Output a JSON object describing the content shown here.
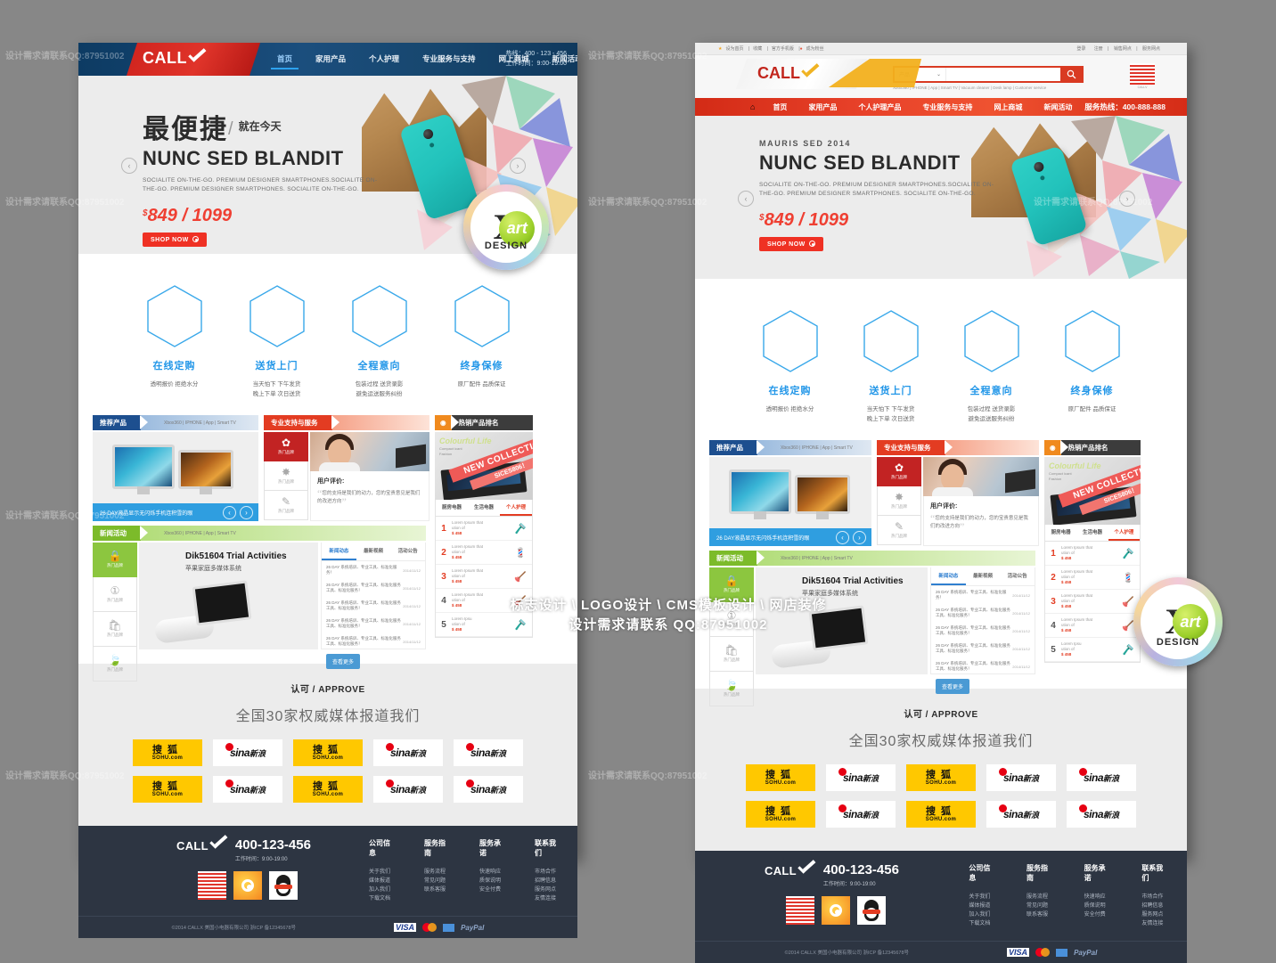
{
  "watermark": {
    "line1": "标志设计 \\ LOGO设计 \\ CMS模板设计 \\ 网店装修",
    "line2": "设计需求请联系 QQ:87951002",
    "faint": "设计需求请联系QQ:87951002"
  },
  "badge": {
    "x": "X",
    "art": "art",
    "design": "DESIGN"
  },
  "left": {
    "brand": "CALL",
    "nav": [
      {
        "label": "首页",
        "active": true
      },
      {
        "label": "家用产品",
        "active": false
      },
      {
        "label": "个人护理",
        "active": false
      },
      {
        "label": "专业服务与支持",
        "active": false
      },
      {
        "label": "网上商城",
        "active": false
      },
      {
        "label": "新闻活动",
        "active": false
      }
    ],
    "hotline_l1": "热线：400 - 123 - 456",
    "hotline_l2": "工作时间：9:00-19:00",
    "hero": {
      "cn_big": "最便捷",
      "cn_slash": "/",
      "cn_small": "就在今天",
      "h1": "NUNC SED BLANDIT",
      "paragraph": "SOCIALITE ON-THE-GO. PREMIUM DESIGNER SMARTPHONES.SOCIALITE ON-THE-GO. PREMIUM DESIGNER SMARTPHONES. SOCIALITE ON-THE-GO.",
      "currency": "$",
      "price": "849 / 1099",
      "cta": "SHOP NOW",
      "arrow_prev": "‹",
      "arrow_next": "›"
    }
  },
  "right": {
    "brand": "CALL",
    "util_left": [
      {
        "label": "设为首页",
        "icon": "star"
      },
      {
        "label": "收藏",
        "icon": ""
      },
      {
        "label": "官方手机版",
        "icon": ""
      },
      {
        "label": "成为粉丝",
        "icon": "dot"
      }
    ],
    "util_right": [
      "登录",
      "注册",
      "销售网点",
      "服务网点"
    ],
    "search": {
      "category": "产品",
      "chevron": "⌄",
      "value": "",
      "placeholder": "",
      "button_icon": "search-icon",
      "keywords": "Xbox360 | IPHONE | App | Smart TV | Vacuum cleaner | Desk lamp | Customer service"
    },
    "qr_caption": "CALLV",
    "nav": [
      {
        "label": "首页"
      },
      {
        "label": "家用产品"
      },
      {
        "label": "个人护理产品"
      },
      {
        "label": "专业服务与支持"
      },
      {
        "label": "网上商城"
      },
      {
        "label": "新闻活动"
      }
    ],
    "nav_hotline": "服务热线：400-888-888",
    "hero": {
      "kicker": "MAURIS SED 2014",
      "h1": "NUNC SED BLANDIT",
      "paragraph": "SOCIALITE ON-THE-GO. PREMIUM DESIGNER SMARTPHONES.SOCIALITE ON-THE-GO. PREMIUM DESIGNER SMARTPHONES. SOCIALITE ON-THE-GO.",
      "currency": "$",
      "price": "849 / 1099",
      "cta": "SHOP NOW",
      "arrow_prev": "‹",
      "arrow_next": "›"
    }
  },
  "features": [
    {
      "title": "在线定购",
      "desc": "透明报价  拒绝水分"
    },
    {
      "title": "送货上门",
      "desc": "当天怕下  下午发货\n晚上下单  次日送货"
    },
    {
      "title": "全程意向",
      "desc": "包装过程  送货录影\n避免运送服务纠纷"
    },
    {
      "title": "终身保修",
      "desc": "原厂配件  品质保证"
    }
  ],
  "panels": {
    "recommend": {
      "tag": "推荐产品",
      "keywords": "Xbox360 | IPHONE | App | Smart TV",
      "caption": "26 DAY液晶显示无闪烁手机连积雪的眼"
    },
    "support": {
      "tag": "专业支持与服务",
      "tiles": [
        {
          "glyph": "✿",
          "label": "热门品牌"
        },
        {
          "glyph": "✸",
          "label": "热门品牌"
        },
        {
          "glyph": "✎",
          "label": "热门品牌"
        }
      ],
      "review_title": "用户评价:",
      "review_text": "您的支持是我们的动力，您的宝贵意见是我们的改进方向"
    },
    "ranking": {
      "tag": "热销产品排名",
      "banner_title": "Colourful Life",
      "banner_sub": "Compact icant\nFashion",
      "ribbon": "NEW COLLECTION",
      "ribbon2": "SICES806！",
      "tabs": [
        {
          "label": "厨房电器",
          "active": false
        },
        {
          "label": "生活电器",
          "active": false
        },
        {
          "label": "个人护理",
          "active": true
        }
      ],
      "rows": [
        {
          "no": "1",
          "title": "Lorem Ipsum that",
          "sub": "ution of",
          "price": "$ 458",
          "icon": "🪒"
        },
        {
          "no": "2",
          "title": "Lorem Ipsum that",
          "sub": "ution of",
          "price": "$ 458",
          "icon": "💈"
        },
        {
          "no": "3",
          "title": "Lorem Ipsum that",
          "sub": "ution of",
          "price": "$ 458",
          "icon": "🪠"
        },
        {
          "no": "4",
          "title": "Lorem Ipsum that",
          "sub": "ution of",
          "price": "$ 458",
          "icon": "🪠"
        },
        {
          "no": "5",
          "title": "Lorem Ipsu",
          "sub": "ution of",
          "price": "$ 458",
          "icon": "🪒"
        }
      ]
    },
    "news": {
      "tag": "新闻活动",
      "keywords": "Xbox360 | IPHONE | App | Smart TV",
      "tiles": [
        {
          "glyph": "🔒",
          "label": "热门品牌"
        },
        {
          "glyph": "①",
          "label": "热门品牌"
        },
        {
          "glyph": "🛍",
          "label": "热门品牌"
        },
        {
          "glyph": "🍃",
          "label": "热门品牌"
        }
      ],
      "headline": "Dik51604 Trial Activities",
      "subhead": "苹果家庭多媒体系统",
      "tabs": [
        {
          "label": "新闻动态",
          "active": true
        },
        {
          "label": "最新视频",
          "active": false
        },
        {
          "label": "活动公告",
          "active": false
        }
      ],
      "items": [
        {
          "text": "26 DAY 系统培训、专业工具、标准化服务！",
          "date": "2014/11/12"
        },
        {
          "text": "26 DAY 系统培训、专业工具、标准化服务工具、标准化服务！",
          "date": "2014/11/12"
        },
        {
          "text": "26 DAY 系统培训、专业工具、标准化服务工具、标准化服务！",
          "date": "2014/11/12"
        },
        {
          "text": "26 DAY 系统培训、专业工具、标准化服务工具、标准化服务！",
          "date": "2014/11/12"
        },
        {
          "text": "26 DAY 系统培训、专业工具、标准化服务工具、标准化服务！",
          "date": "2014/11/12"
        }
      ],
      "more": "查看更多"
    }
  },
  "approve": {
    "title": "认可 / APPROVE",
    "subtitle": "全国30家权威媒体报道我们",
    "logos_row1": [
      "sohu",
      "sina",
      "sohu",
      "sina",
      "sina"
    ],
    "logos_row2": [
      "sohu",
      "sina",
      "sohu",
      "sina",
      "sina"
    ],
    "sohu_cn": "搜狐",
    "sohu_en": "SOHU.com",
    "sina_en": "sina",
    "sina_cn": "新浪"
  },
  "footer": {
    "brand": "CALL",
    "tel": "400-123-456",
    "time": "工作时间：9:00-19:00",
    "socials": [
      "qrcode-icon",
      "weibo-icon",
      "qq-icon"
    ],
    "columns": [
      {
        "title": "公司信息",
        "links": [
          "关于我们",
          "媒体报道",
          "加入我们",
          "下载文档"
        ]
      },
      {
        "title": "服务指南",
        "links": [
          "服务流程",
          "常见问题",
          "联系客服"
        ]
      },
      {
        "title": "服务承诺",
        "links": [
          "快速响应",
          "质保说明",
          "安全付费"
        ]
      },
      {
        "title": "联系我们",
        "links": [
          "市场合作",
          "招聘信息",
          "服务网点",
          "友情连接"
        ]
      }
    ],
    "copyright": "©2014 CALLX 美国小电器有限公司 浙ICP 备12345678号",
    "payments": [
      "VISA",
      "MasterCard",
      "Card",
      "PayPal"
    ],
    "pay_visa": "VISA",
    "pay_paypal": "PayPal"
  }
}
